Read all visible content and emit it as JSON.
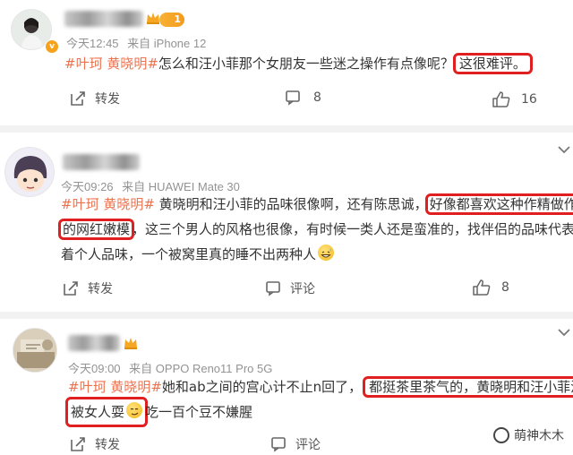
{
  "comments": [
    {
      "time": "今天12:45",
      "from": "来自 iPhone 12",
      "level": "1",
      "tag": "#叶珂 黄晓明#",
      "text1": "怎么和汪小菲那个女朋友一些迷之操作有点像呢？",
      "highlight1": "这很难评。",
      "repost": "转发",
      "comment_count": "8",
      "like_count": "16"
    },
    {
      "time": "今天09:26",
      "from": "来自 HUAWEI Mate 30",
      "tag": "#叶珂 黄晓明#",
      "line1_text": " 黄晓明和汪小菲的品味很像啊，还有陈思诚，",
      "line1_hl": "好像都喜欢这种作精做作",
      "line2_hl": "的网红嫩模",
      "line2_text": "，这三个男人的风格也很像，有时候一类人还是蛮准的，找伴侣的品味代表",
      "line3_text": "着个人品味，一个被窝里真的睡不出两种人",
      "repost": "转发",
      "comment_label": "评论",
      "like_count": "8"
    },
    {
      "time": "今天09:00",
      "from": "来自 OPPO Reno11 Pro 5G",
      "tag": "#叶珂 黄晓明#",
      "line1_text": "她和ab之间的宫心计不止n回了，",
      "line1_hl": "都挺茶里茶气的，黄晓明和汪小菲活该",
      "line2_hl": "被女人耍",
      "line2_text": "吃一百个豆不嫌腥",
      "repost": "转发",
      "comment_label": "评论"
    }
  ],
  "watermark": "萌神木木",
  "colors": {
    "tag": "#eb7350",
    "highlight_box": "#e02020",
    "meta": "#939393"
  }
}
